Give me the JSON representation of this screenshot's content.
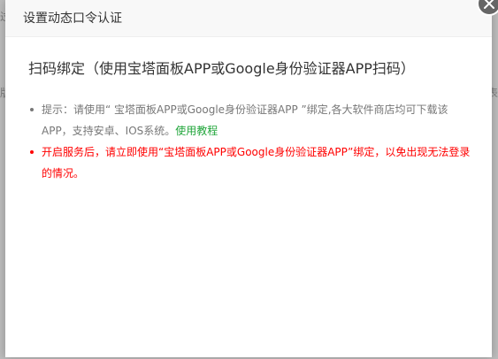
{
  "backdrop": {
    "left_fragment_top": "过",
    "left_fragment_mid": "版",
    "right_fragment_mid": "表"
  },
  "dialog": {
    "title": "设置动态口令认证",
    "section_title": "扫码绑定（使用宝塔面板APP或Google身份验证器APP扫码）",
    "tips": [
      {
        "text": "提示：请使用“ 宝塔面板APP或Google身份验证器APP ”绑定,各大软件商店均可下载该APP，支持安卓、IOS系统。",
        "link": "使用教程"
      },
      {
        "text": "开启服务后，请立即使用“宝塔面板APP或Google身份验证器APP”绑定，以免出现无法登录的情况。"
      }
    ],
    "close_icon": "close-icon"
  },
  "colors": {
    "overlay": "#bdbdbd",
    "header_bg": "#f8f8f8",
    "tip_gray": "#777777",
    "tip_red": "#ff0000",
    "link_green": "#20a53a",
    "close_bg": "#666666"
  }
}
